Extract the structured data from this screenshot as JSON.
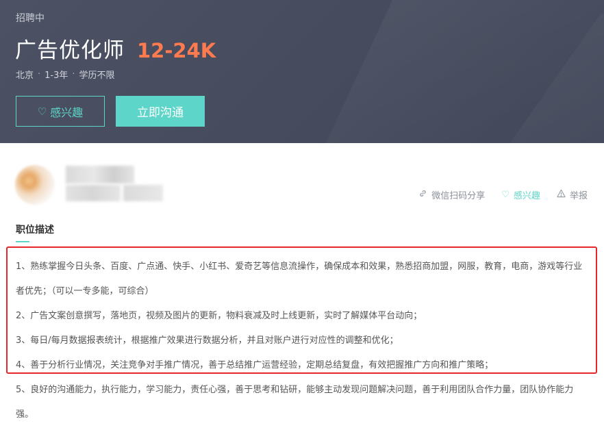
{
  "header": {
    "status": "招聘中",
    "job_title": "广告优化师",
    "salary": "12-24K",
    "meta": [
      "北京",
      "1-3年",
      "学历不限"
    ],
    "meta_separator": "·",
    "interest_button": "感兴趣",
    "chat_button": "立即沟通"
  },
  "actions": {
    "share": "微信扫码分享",
    "interest": "感兴趣",
    "report": "举报"
  },
  "section": {
    "title": "职位描述"
  },
  "description": [
    "1、熟练掌握今日头条、百度、广点通、快手、小红书、爱奇艺等信息流操作，确保成本和效果，熟悉招商加盟，网服，教育，电商，游戏等行业者优先；（可以一专多能，可综合）",
    "2、广告文案创意撰写，落地页，视频及图片的更新，物料衰减及时上线更新，实时了解媒体平台动向；",
    "3、每日/每月数据报表统计，根据推广效果进行数据分析，并且对账户进行对应性的调整和优化；",
    "4、善于分析行业情况，关注竞争对手推广情况，善于总结推广运营经验，定期总结复盘，有效把握推广方向和推广策略；",
    "5、良好的沟通能力，执行能力，学习能力，责任心强，善于思考和钻研，能够主动发现问题解决问题，善于利用团队合作力量，团队协作能力强。"
  ],
  "colors": {
    "accent": "#5dd5c8",
    "salary": "#fe7a4f",
    "header_bg": "#4c5264",
    "highlight": "#e5262a"
  },
  "icons": {
    "heart": "heart-icon",
    "link": "link-icon",
    "warning": "warning-icon"
  }
}
